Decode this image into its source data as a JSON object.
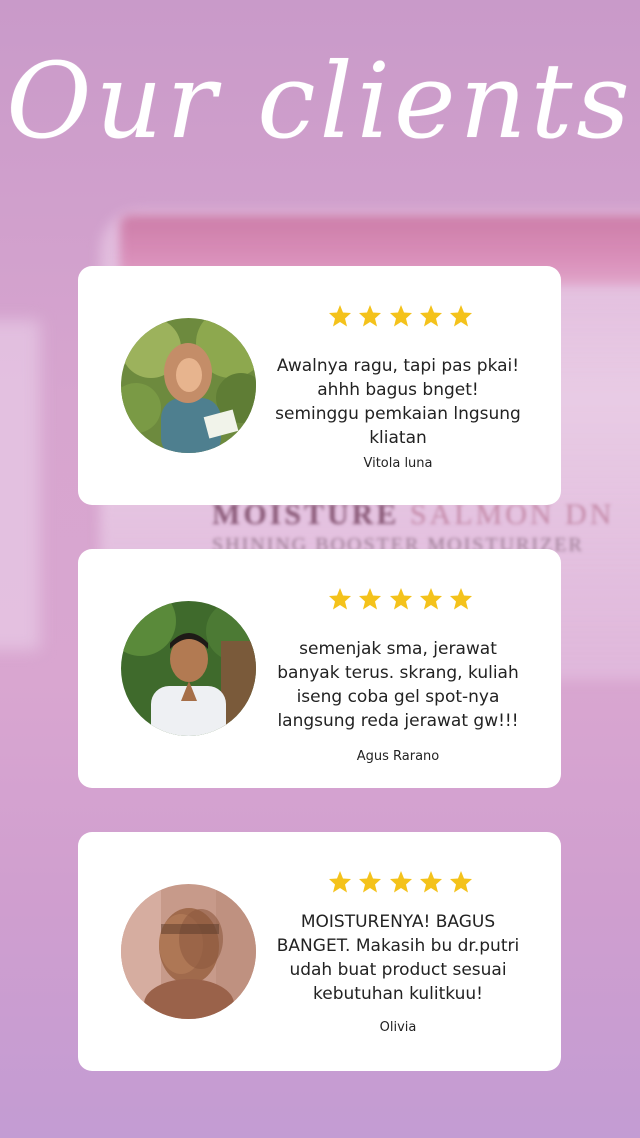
{
  "title": "Our clients",
  "background_text": {
    "line1_a": "MOISTURE",
    "line1_b": "SALMON DN",
    "line2": "SHINING BOOSTER MOISTURIZER"
  },
  "colors": {
    "star": "#f4c21b",
    "card": "#ffffff"
  },
  "testimonials": [
    {
      "rating": 5,
      "text": "Awalnya ragu, tapi pas pkai! ahhh bagus bnget! seminggu pemkaian lngsung kliatan",
      "name": "Vitola luna",
      "avatar_icon": "woman-in-hijab-photo"
    },
    {
      "rating": 5,
      "text": "semenjak sma, jerawat banyak terus. skrang, kuliah iseng coba gel spot-nya langsung reda jerawat gw!!!",
      "name": "Agus Rarano",
      "avatar_icon": "smiling-man-photo"
    },
    {
      "rating": 5,
      "text": "MOISTURENYA! BAGUS BANGET. Makasih bu dr.putri udah buat product sesuai kebutuhan kulitkuu!",
      "name": "Olivia",
      "avatar_icon": "blurred-portrait-photo"
    }
  ]
}
